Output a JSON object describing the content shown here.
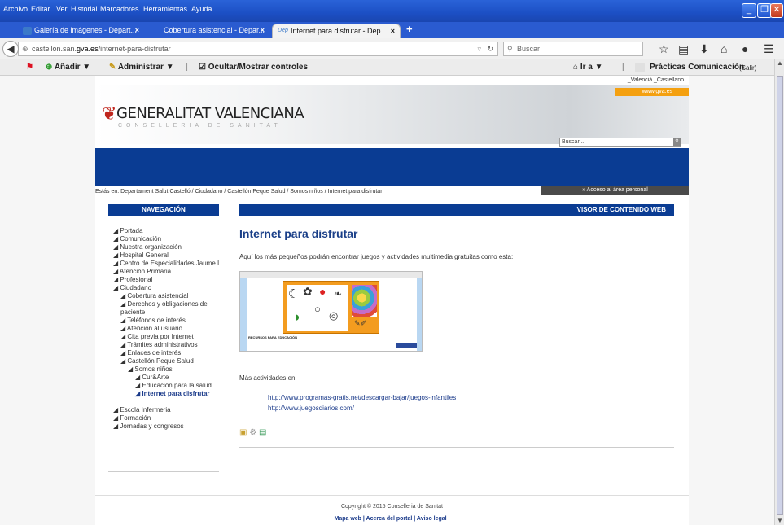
{
  "menubar": {
    "items": [
      "Archivo",
      "Editar",
      "Ver",
      "Historial",
      "Marcadores",
      "Herramientas",
      "Ayuda"
    ]
  },
  "tabs": [
    {
      "label": "Galería de imágenes - Depart...",
      "close": "×"
    },
    {
      "label": "Cobertura asistencial - Depar...",
      "close": "×"
    },
    {
      "label": "Internet para disfrutar - Dep...",
      "close": "×",
      "icon_text": "Dep"
    }
  ],
  "newtab_label": "+",
  "url": {
    "prefix": "castellon.san.",
    "host": "gva.es",
    "path": "/internet-para-disfrutar"
  },
  "search_placeholder": "Buscar",
  "bookmarks": {
    "add": "Añadir ▼",
    "manage": "Administrar ▼",
    "toggle": "Ocultar/Mostrar controles",
    "goto": "Ir a ▼",
    "profile": "Prácticas Comunicación",
    "logout": "(Salir)"
  },
  "site": {
    "lang_links": "_Valencià _Castellano",
    "gva_badge": "www.gva.es",
    "logo_title": "GENERALITAT VALENCIANA",
    "logo_sub": "CONSELLERIA DE SANITAT",
    "search_placeholder": "Buscar...",
    "breadcrumb": "Estás en: Departament Salut Castelló / Ciudadano / Castellón Peque Salud / Somos niños / Internet para disfrutar",
    "access_badge": "» Acceso al área personal"
  },
  "leftnav": {
    "header": "NAVEGACIÓN",
    "items": [
      {
        "label": "◢ Portada",
        "indent": 0
      },
      {
        "label": "◢ Comunicación",
        "indent": 0
      },
      {
        "label": "◢ Nuestra organización",
        "indent": 0
      },
      {
        "label": "◢ Hospital General",
        "indent": 0
      },
      {
        "label": "◢ Centro de Especialidades Jaume I",
        "indent": 0
      },
      {
        "label": "◢ Atención Primaria",
        "indent": 0
      },
      {
        "label": "◢ Profesional",
        "indent": 0
      },
      {
        "label": "◢ Ciudadano",
        "indent": 0
      },
      {
        "label": "◢ Cobertura asistencial",
        "indent": 1
      },
      {
        "label": "◢ Derechos y obligaciones del paciente",
        "indent": 1
      },
      {
        "label": "◢ Teléfonos de interés",
        "indent": 1
      },
      {
        "label": "◢ Atención al usuario",
        "indent": 1
      },
      {
        "label": "◢ Cita previa por Internet",
        "indent": 1
      },
      {
        "label": "◢ Trámites administrativos",
        "indent": 1
      },
      {
        "label": "◢ Enlaces de interés",
        "indent": 1
      },
      {
        "label": "◢ Castellón Peque Salud",
        "indent": 1
      },
      {
        "label": "◢ Somos niños",
        "indent": 2
      },
      {
        "label": "◢ Cur&Arte",
        "indent": 3
      },
      {
        "label": "◢ Educación para la salud",
        "indent": 3
      },
      {
        "label": "◢ Internet para disfrutar",
        "indent": 3,
        "active": true
      },
      {
        "label": "◢ Escola Infermeria",
        "indent": 0,
        "gap": true
      },
      {
        "label": "◢ Formación",
        "indent": 0
      },
      {
        "label": "◢ Jornadas y congresos",
        "indent": 0
      }
    ]
  },
  "content": {
    "header": "VISOR DE CONTENIDO WEB",
    "title": "Internet para disfrutar",
    "intro": "Aquí los más pequeños podrán encontrar juegos y actividades multimedia gratuitas como esta:",
    "thumb_caption": "RECURSOS PARA EDUCACIÓN",
    "more_label": "Más actividades en:",
    "links": [
      "http://www.programas-gratis.net/descargar-bajar/juegos-infantiles",
      "http://www.juegosdiarios.com/"
    ]
  },
  "footer": {
    "copyright": "Copyright © 2015 Conselleria de Sanitat",
    "links": "Mapa web | Acerca del portal | Aviso legal |"
  }
}
